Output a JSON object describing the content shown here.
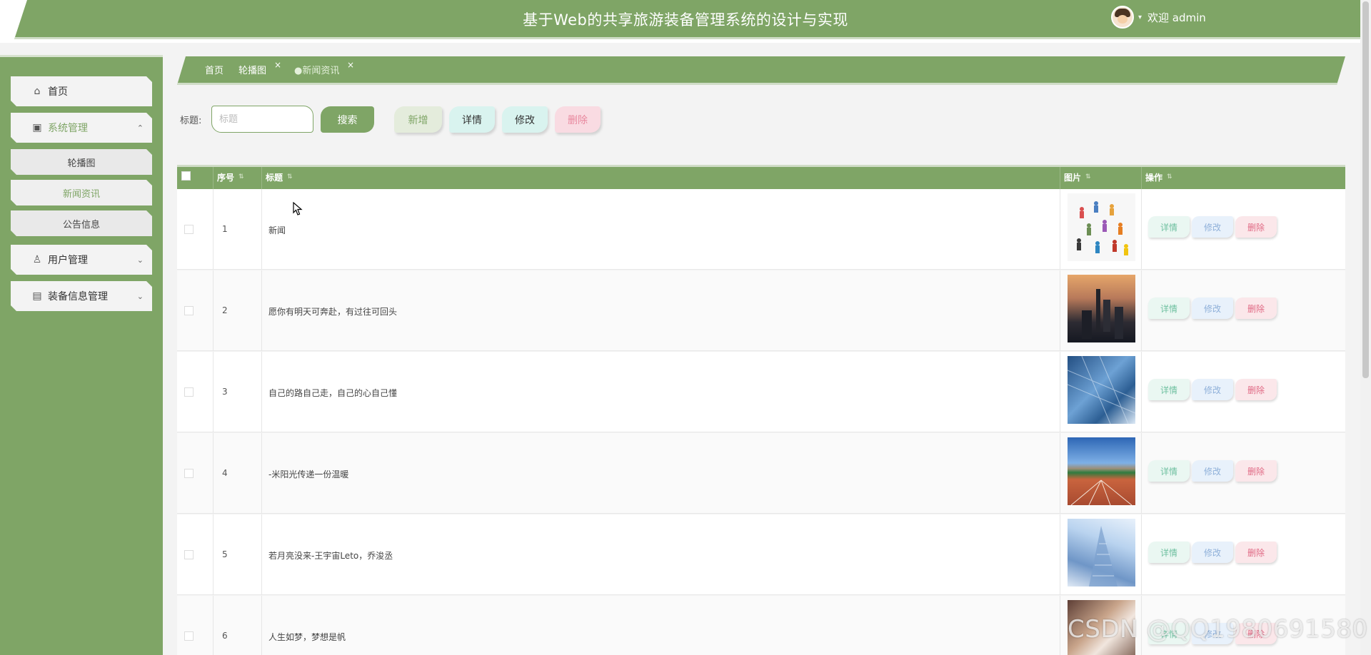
{
  "header": {
    "title": "基于Web的共享旅游装备管理系统的设计与实现",
    "welcome": "欢迎 admin"
  },
  "sidebar": {
    "items": [
      {
        "label": "首页",
        "icon": "home-icon"
      },
      {
        "label": "系统管理",
        "icon": "settings-card-icon",
        "expanded": true,
        "children": [
          {
            "label": "轮播图"
          },
          {
            "label": "新闻资讯",
            "active": true
          },
          {
            "label": "公告信息"
          }
        ]
      },
      {
        "label": "用户管理",
        "icon": "user-badge-icon"
      },
      {
        "label": "装备信息管理",
        "icon": "briefcase-icon"
      }
    ]
  },
  "tabs": [
    {
      "label": "首页"
    },
    {
      "label": "轮播图",
      "close": "×"
    },
    {
      "label": "●新闻资讯",
      "close": "×",
      "active": true
    }
  ],
  "search": {
    "label": "标题:",
    "placeholder": "标题",
    "search_button": "搜索"
  },
  "toolbar": {
    "add": "新增",
    "detail": "详情",
    "edit": "修改",
    "delete": "删除"
  },
  "table": {
    "columns": [
      "序号",
      "标题",
      "图片",
      "操作"
    ],
    "rows": [
      {
        "index": "1",
        "title": "新闻",
        "image": "people-illustration"
      },
      {
        "index": "2",
        "title": "愿你有明天可奔赴，有过往可回头",
        "image": "city-sunset-photo"
      },
      {
        "index": "3",
        "title": "自己的路自己走，自己的心自己懂",
        "image": "glass-tower-photo"
      },
      {
        "index": "4",
        "title": "-米阳光传递一份温暖",
        "image": "running-track-photo"
      },
      {
        "index": "5",
        "title": "若月亮没来-王宇宙Leto，乔浚丞",
        "image": "skyscraper-photo"
      },
      {
        "index": "6",
        "title": "人生如梦，梦想是帆",
        "image": "hands-photo"
      }
    ],
    "row_actions": {
      "detail": "详情",
      "edit": "修改",
      "delete": "删除"
    }
  },
  "watermark": "CSDN @QQ1980691580",
  "colors": {
    "primary": "#7fa566",
    "detail": "#6fc0a0",
    "edit": "#8fb0d9",
    "delete": "#e06a85"
  }
}
